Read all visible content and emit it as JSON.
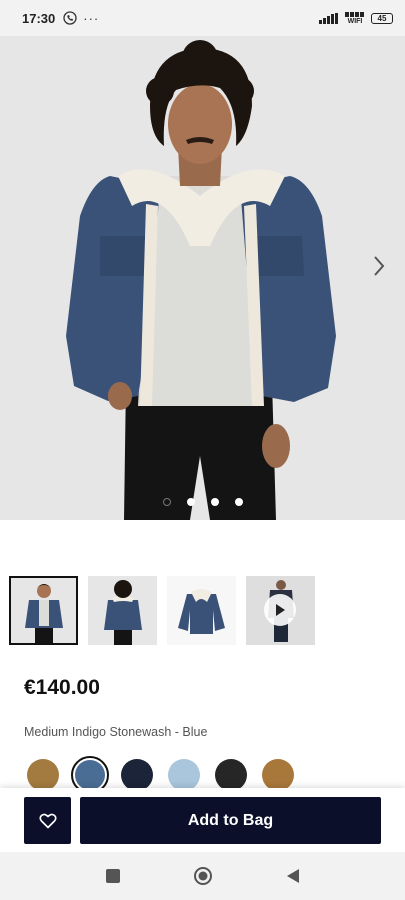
{
  "status_bar": {
    "time": "17:30",
    "dots": "···",
    "wifi_label": "WIFI",
    "battery": "45"
  },
  "hero": {
    "image_label": "Product model photo",
    "carousel_dots": 4,
    "active_dot": 0
  },
  "thumbnails": [
    {
      "name": "front-model",
      "selected": true
    },
    {
      "name": "back-model",
      "selected": false
    },
    {
      "name": "flat-lay",
      "selected": false
    },
    {
      "name": "video",
      "selected": false
    }
  ],
  "product": {
    "price": "€140.00",
    "color_name": "Medium Indigo Stonewash - Blue"
  },
  "swatches": [
    {
      "color": "#a37a3f",
      "selected": false
    },
    {
      "color": "#4a6d95",
      "selected": true
    },
    {
      "color": "#1b2438",
      "selected": false
    },
    {
      "color": "#a9c6dd",
      "selected": false
    },
    {
      "color": "#262626",
      "selected": false
    },
    {
      "color": "#a8783a",
      "selected": false
    }
  ],
  "actions": {
    "add_to_bag": "Add to Bag"
  },
  "colors": {
    "primary": "#0b0f2a",
    "hero_bg": "#e6e6e6"
  }
}
